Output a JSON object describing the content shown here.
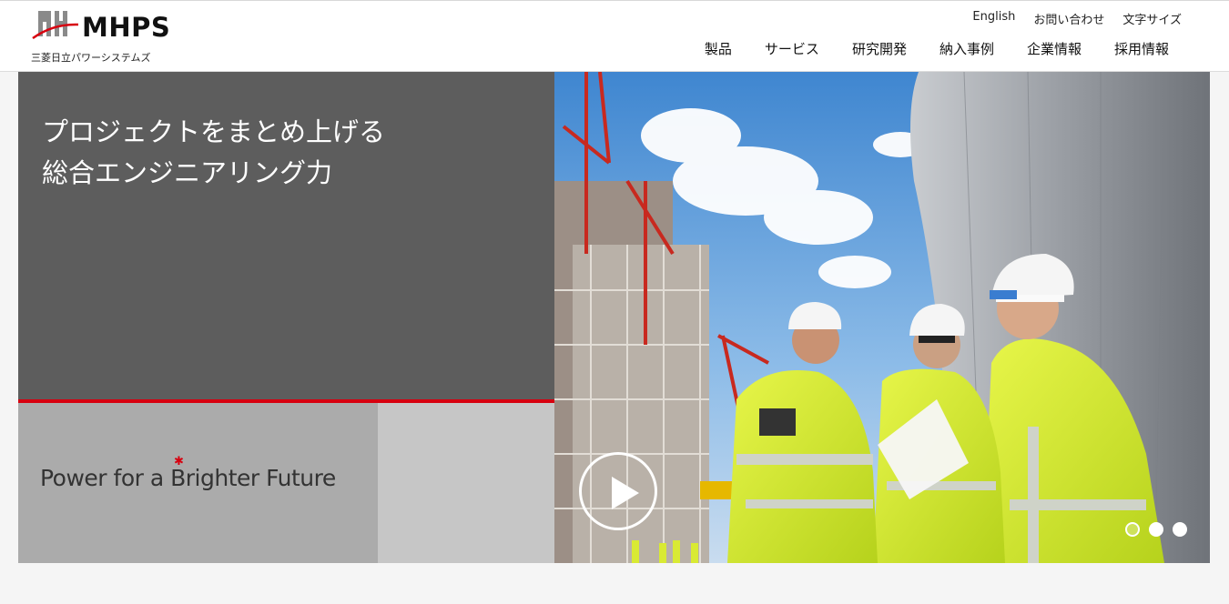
{
  "brand": {
    "name": "MHPS",
    "mark_text": "MH",
    "subtitle": "三菱日立パワーシステムズ",
    "accent_color": "#d7000f"
  },
  "utility_nav": [
    "English",
    "お問い合わせ",
    "文字サイズ"
  ],
  "main_nav": [
    "製品",
    "サービス",
    "研究開発",
    "納入事例",
    "企業情報",
    "採用情報"
  ],
  "hero": {
    "headline_line1": "プロジェクトをまとめ上げる",
    "headline_line2": "総合エンジニアリング力",
    "tagline": "Power for a Brighter Future",
    "play_icon": "play-icon",
    "slide_count": 3,
    "active_slide": 1
  }
}
